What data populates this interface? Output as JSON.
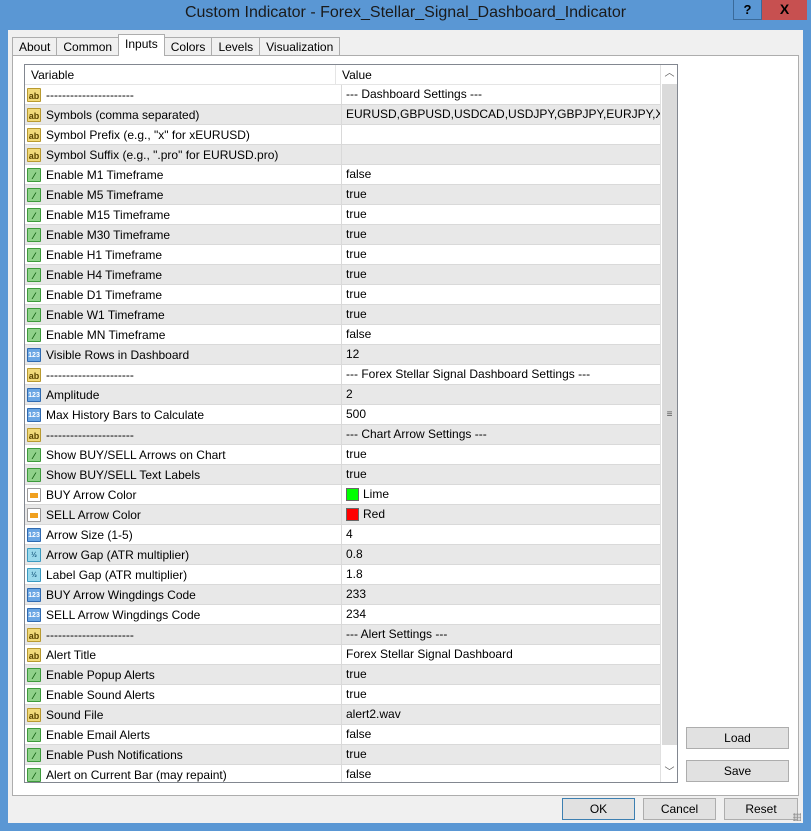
{
  "window": {
    "title": "Custom Indicator - Forex_Stellar_Signal_Dashboard_Indicator",
    "help_label": "?",
    "close_label": "X"
  },
  "tabs": [
    {
      "label": "About"
    },
    {
      "label": "Common"
    },
    {
      "label": "Inputs",
      "active": true
    },
    {
      "label": "Colors"
    },
    {
      "label": "Levels"
    },
    {
      "label": "Visualization"
    }
  ],
  "table": {
    "columns": [
      "Variable",
      "Value"
    ],
    "rows": [
      {
        "type": "str",
        "variable": "----------------------",
        "value": "--- Dashboard Settings ---"
      },
      {
        "type": "str",
        "variable": "Symbols (comma separated)",
        "value": "EURUSD,GBPUSD,USDCAD,USDJPY,GBPJPY,EURJPY,XAU..."
      },
      {
        "type": "str",
        "variable": "Symbol Prefix (e.g., \"x\" for xEURUSD)",
        "value": ""
      },
      {
        "type": "str",
        "variable": "Symbol Suffix (e.g., \".pro\" for EURUSD.pro)",
        "value": ""
      },
      {
        "type": "bool",
        "variable": "Enable M1 Timeframe",
        "value": "false"
      },
      {
        "type": "bool",
        "variable": "Enable M5 Timeframe",
        "value": "true"
      },
      {
        "type": "bool",
        "variable": "Enable M15 Timeframe",
        "value": "true"
      },
      {
        "type": "bool",
        "variable": "Enable M30 Timeframe",
        "value": "true"
      },
      {
        "type": "bool",
        "variable": "Enable H1 Timeframe",
        "value": "true"
      },
      {
        "type": "bool",
        "variable": "Enable H4 Timeframe",
        "value": "true"
      },
      {
        "type": "bool",
        "variable": "Enable D1 Timeframe",
        "value": "true"
      },
      {
        "type": "bool",
        "variable": "Enable W1 Timeframe",
        "value": "true"
      },
      {
        "type": "bool",
        "variable": "Enable MN Timeframe",
        "value": "false"
      },
      {
        "type": "int",
        "variable": "Visible Rows in Dashboard",
        "value": "12"
      },
      {
        "type": "str",
        "variable": "----------------------",
        "value": "--- Forex Stellar Signal Dashboard Settings ---"
      },
      {
        "type": "int",
        "variable": "Amplitude",
        "value": "2"
      },
      {
        "type": "int",
        "variable": "Max History Bars to Calculate",
        "value": "500"
      },
      {
        "type": "str",
        "variable": "----------------------",
        "value": "--- Chart Arrow Settings ---"
      },
      {
        "type": "bool",
        "variable": "Show BUY/SELL Arrows on Chart",
        "value": "true"
      },
      {
        "type": "bool",
        "variable": "Show BUY/SELL Text Labels",
        "value": "true"
      },
      {
        "type": "col",
        "variable": "BUY Arrow Color",
        "value": "Lime",
        "swatch": "#00ff00"
      },
      {
        "type": "col",
        "variable": "SELL Arrow Color",
        "value": "Red",
        "swatch": "#ff0000"
      },
      {
        "type": "int",
        "variable": "Arrow Size (1-5)",
        "value": "4"
      },
      {
        "type": "dbl",
        "variable": "Arrow Gap (ATR multiplier)",
        "value": "0.8"
      },
      {
        "type": "dbl",
        "variable": "Label Gap (ATR multiplier)",
        "value": "1.8"
      },
      {
        "type": "int",
        "variable": "BUY Arrow Wingdings Code",
        "value": "233"
      },
      {
        "type": "int",
        "variable": "SELL Arrow Wingdings Code",
        "value": "234"
      },
      {
        "type": "str",
        "variable": "----------------------",
        "value": "--- Alert Settings ---"
      },
      {
        "type": "str",
        "variable": "Alert Title",
        "value": "Forex Stellar Signal Dashboard"
      },
      {
        "type": "bool",
        "variable": "Enable Popup Alerts",
        "value": "true"
      },
      {
        "type": "bool",
        "variable": "Enable Sound Alerts",
        "value": "true"
      },
      {
        "type": "str",
        "variable": "Sound File",
        "value": "alert2.wav"
      },
      {
        "type": "bool",
        "variable": "Enable Email Alerts",
        "value": "false"
      },
      {
        "type": "bool",
        "variable": "Enable Push Notifications",
        "value": "true"
      },
      {
        "type": "bool",
        "variable": "Alert on Current Bar (may repaint)",
        "value": "false"
      }
    ]
  },
  "icons": {
    "str": "ab",
    "bool": "⁄",
    "int": "123",
    "dbl": "½",
    "col": ""
  },
  "buttons": {
    "load": "Load",
    "save": "Save",
    "ok": "OK",
    "cancel": "Cancel",
    "reset": "Reset"
  }
}
